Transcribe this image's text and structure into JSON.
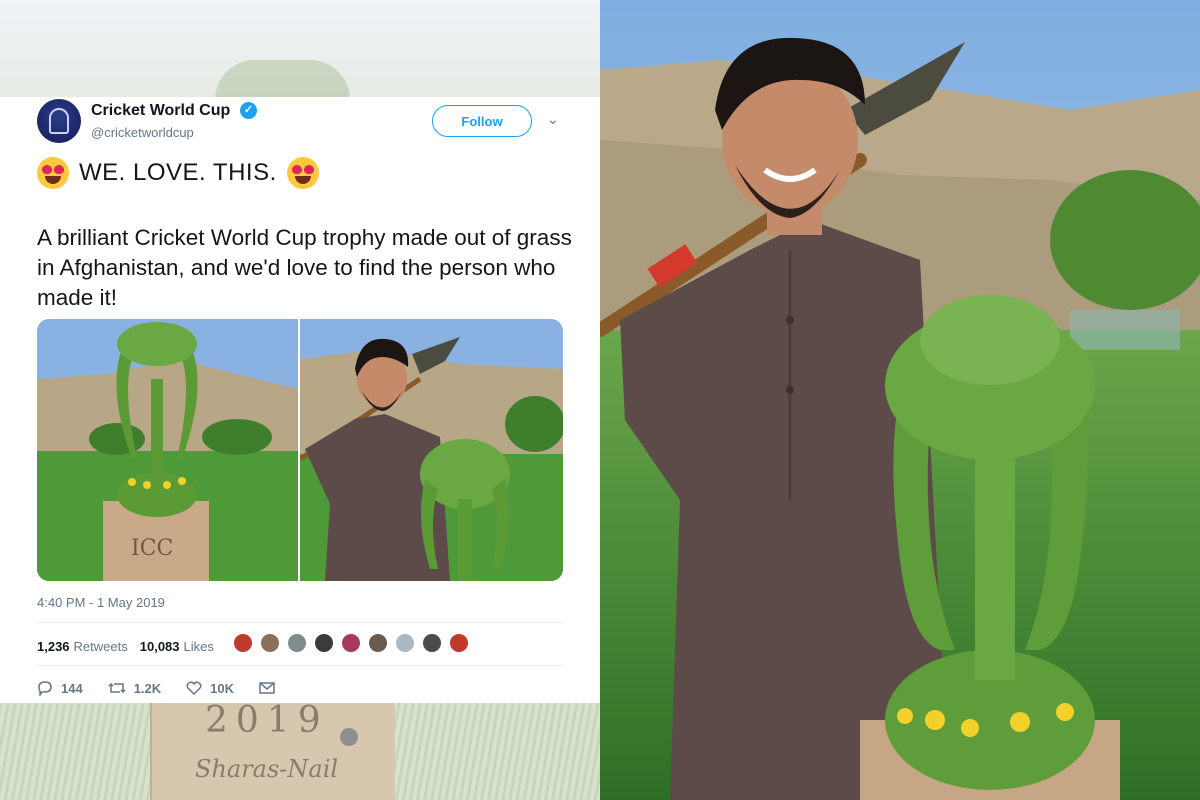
{
  "tweet": {
    "display_name": "Cricket World Cup",
    "handle": "@cricketworldcup",
    "verified": true,
    "follow_label": "Follow",
    "headline": "WE. LOVE. THIS.",
    "body": "A brilliant Cricket World Cup trophy made out of grass in Afghanistan, and we'd love to find the person who made it!",
    "timestamp": "4:40 PM - 1 May 2019",
    "retweets_count": "1,236",
    "retweets_label": "Retweets",
    "likes_count": "10,083",
    "likes_label": "Likes",
    "actions": {
      "replies": "144",
      "retweets": "1.2K",
      "likes": "10K"
    },
    "media_box_text": "ICC"
  },
  "background": {
    "box_text_top": "2019",
    "box_text_bottom": "Sharas-Nail"
  },
  "colors": {
    "accent": "#1da1f2",
    "text_primary": "#14171a",
    "text_secondary": "#657786",
    "divider": "#e6ecf0",
    "emoji_heart": "#e0245e",
    "emoji_face": "#ffc83d"
  },
  "icons": [
    "verified-badge-icon",
    "chevron-down-icon",
    "heart-eyes-emoji",
    "reply-icon",
    "retweet-icon",
    "like-icon",
    "message-icon"
  ]
}
